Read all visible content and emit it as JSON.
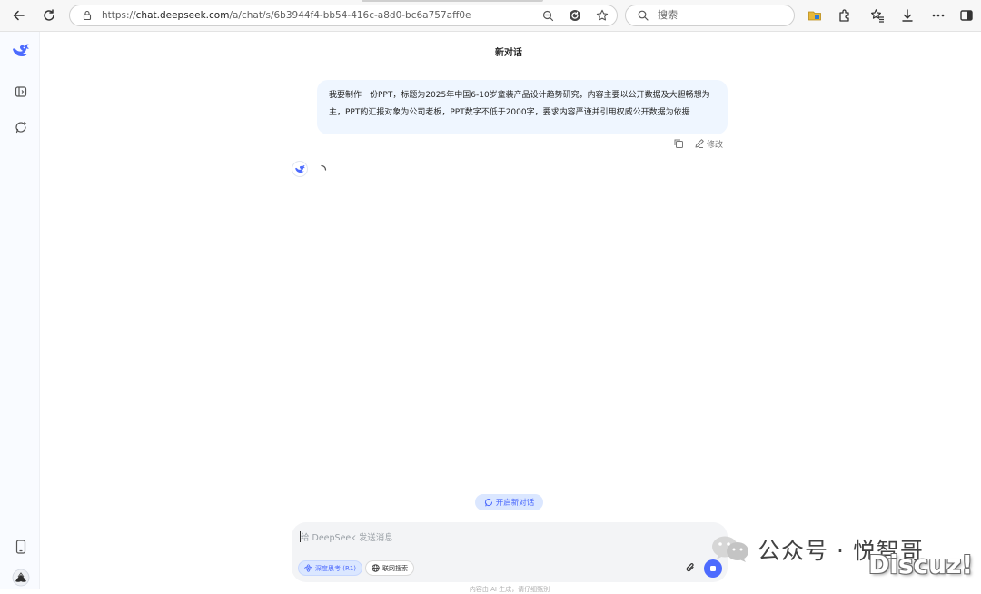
{
  "browser": {
    "url_prefix": "https://",
    "url_host": "chat.deepseek.com",
    "url_path": "/a/chat/s/6b3944f4-bb54-416c-a8d0-bc6a757aff0e",
    "search_placeholder": "搜索"
  },
  "chat": {
    "title": "新对话",
    "user_message": "我要制作一份PPT，标题为2025年中国6-10岁童装产品设计趋势研究，内容主要以公开数据及大胆畅想为主，PPT的汇报对象为公司老板，PPT数字不低于2000字，要求内容严谨并引用权威公开数据为依据",
    "edit_label": "修改"
  },
  "footer": {
    "new_chat_label": "开启新对话",
    "input_placeholder": "给 DeepSeek 发送消息",
    "deep_think_label": "深度思考 (R1)",
    "web_search_label": "联网搜索",
    "disclaimer": "内容由 AI 生成，请仔细甄别"
  },
  "watermark": {
    "text": "公众号 · 悦智哥",
    "site": "Discuz!"
  },
  "colors": {
    "accent": "#4d6bfe",
    "bubble": "#eff6ff",
    "pill": "#dbe7ff"
  },
  "icons": [
    "back-icon",
    "reload-icon",
    "lock-icon",
    "zoom-icon",
    "refresh-badge-icon",
    "star-icon",
    "search-icon",
    "folder-icon",
    "extensions-icon",
    "favorites-icon",
    "download-icon",
    "more-icon",
    "sidebar-icon",
    "whale-logo-icon",
    "panel-toggle-icon",
    "new-chat-icon",
    "phone-icon",
    "copy-icon",
    "pencil-icon",
    "spinner-icon",
    "atom-icon",
    "globe-icon",
    "paperclip-icon",
    "stop-icon",
    "wechat-icon"
  ]
}
